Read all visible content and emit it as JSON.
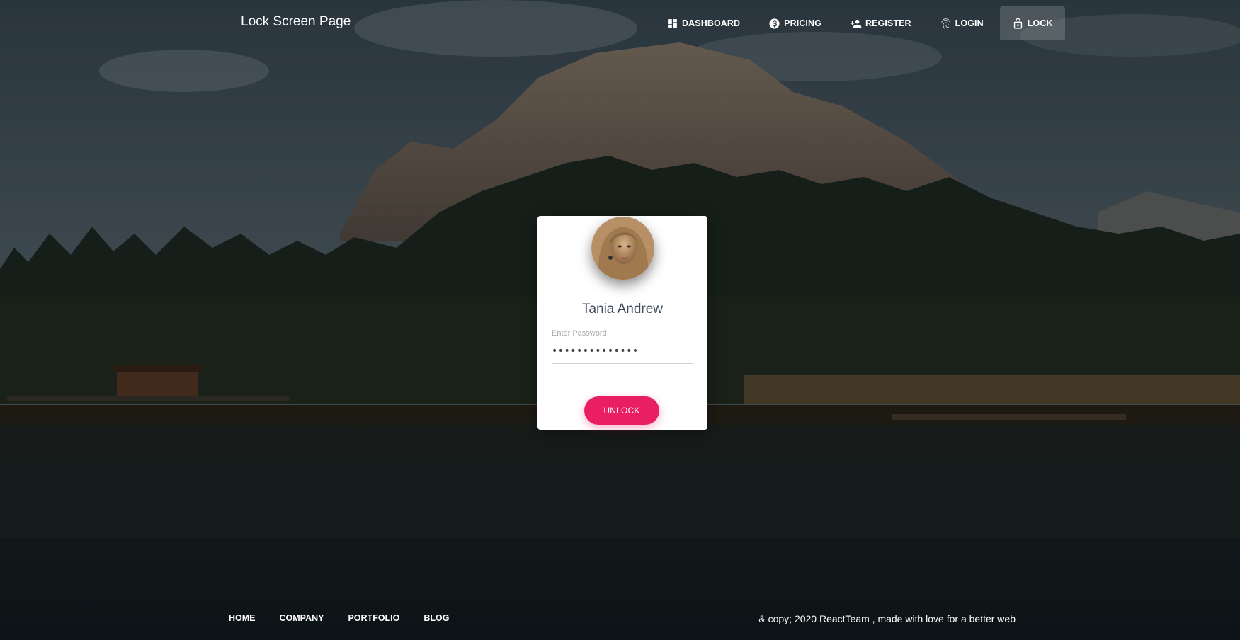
{
  "navbar": {
    "brand": "Lock Screen Page",
    "links": [
      {
        "label": "DASHBOARD",
        "icon": "dashboard-icon",
        "active": false
      },
      {
        "label": "PRICING",
        "icon": "dollar-icon",
        "active": false
      },
      {
        "label": "REGISTER",
        "icon": "person-add-icon",
        "active": false
      },
      {
        "label": "LOGIN",
        "icon": "fingerprint-icon",
        "active": false
      },
      {
        "label": "LOCK",
        "icon": "lock-open-icon",
        "active": true
      }
    ]
  },
  "lock_card": {
    "avatar": "user-avatar",
    "user_name": "Tania Andrew",
    "password_label": "Enter Password",
    "password_value": "••••••••••••••",
    "unlock_label": "UNLOCK"
  },
  "footer": {
    "links": [
      "HOME",
      "COMPANY",
      "PORTFOLIO",
      "BLOG"
    ],
    "copyright": "& copy; 2020 ReactTeam , made with love for a better web"
  },
  "colors": {
    "accent": "#e91e63",
    "card_bg": "#ffffff",
    "nav_active_bg": "rgba(255,255,255,0.16)"
  }
}
